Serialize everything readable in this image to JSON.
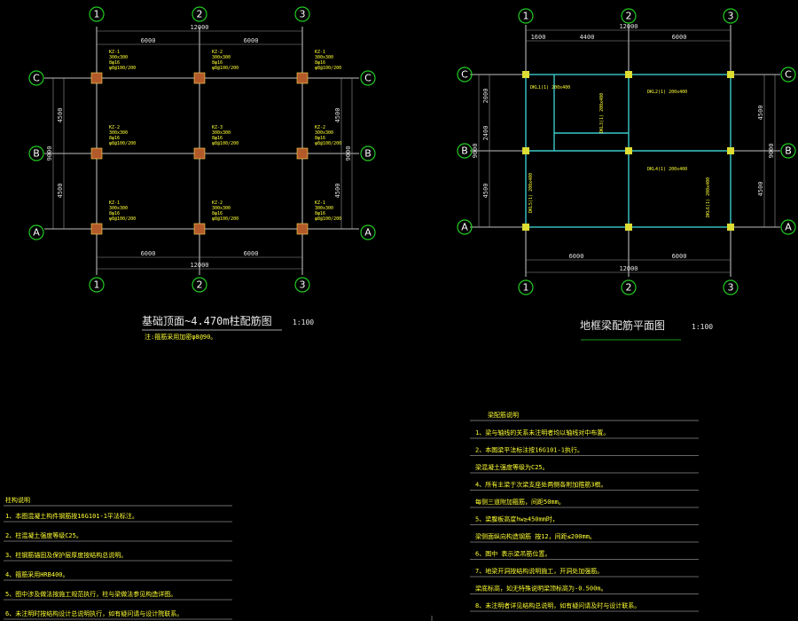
{
  "left_drawing": {
    "title": "基础顶面~4.470m柱配筋图",
    "scale": "1:100",
    "note": "注:箍筋采用加密φ8@90。",
    "axes_x": [
      "1",
      "2",
      "3"
    ],
    "axes_y": [
      "A",
      "B",
      "C"
    ],
    "dim_total": "12000",
    "dim_spans": [
      "6000",
      "6000"
    ],
    "dim_side": [
      "4500",
      "4500"
    ],
    "dim_side_total": "9000",
    "columns": [
      {
        "mark": "KZ-1",
        "size": "300x300",
        "bars": "8φ16",
        "stirrup": "φ8@100/200"
      },
      {
        "mark": "KZ-2",
        "size": "300x300",
        "bars": "8φ16",
        "stirrup": "φ8@100/200"
      },
      {
        "mark": "KZ-1",
        "size": "300x300",
        "bars": "8φ16",
        "stirrup": "φ8@100/200"
      },
      {
        "mark": "KZ-2",
        "size": "300x300",
        "bars": "8φ16",
        "stirrup": "φ8@100/200"
      },
      {
        "mark": "KZ-3",
        "size": "300x300",
        "bars": "8φ16",
        "stirrup": "φ8@100/200"
      },
      {
        "mark": "KZ-2",
        "size": "300x300",
        "bars": "8φ16",
        "stirrup": "φ8@100/200"
      },
      {
        "mark": "KZ-1",
        "size": "300x300",
        "bars": "8φ16",
        "stirrup": "φ8@100/200"
      },
      {
        "mark": "KZ-2",
        "size": "300x300",
        "bars": "8φ16",
        "stirrup": "φ8@100/200"
      },
      {
        "mark": "KZ-1",
        "size": "300x300",
        "bars": "8φ16",
        "stirrup": "φ8@100/200"
      }
    ]
  },
  "right_drawing": {
    "title": "地框梁配筋平面图",
    "scale": "1:100",
    "axes_x": [
      "1",
      "2",
      "3"
    ],
    "axes_y": [
      "A",
      "B",
      "C"
    ],
    "dim_total": "12000",
    "dim_top": [
      "1600",
      "4400",
      "6000"
    ],
    "dim_bottom": [
      "6000",
      "6000"
    ],
    "dim_left": [
      "2000",
      "2400",
      "4500"
    ],
    "dim_side_total": "9000",
    "dim_right": [
      "4500",
      "4500"
    ],
    "beam_labels": [
      "DKL1(1) 200x400",
      "DKL2(1) 200x400",
      "DKL3(1) 200x400",
      "DKL4(1) 200x400",
      "DKL5(1) 200x400",
      "DKL6(1) 200x400"
    ]
  },
  "notes_left": {
    "heading": "柱构说明",
    "lines": [
      "1、本图混凝土构件钢筋按16G101-1平法标注。",
      "2、柱混凝土强度等级C25。",
      "3、柱钢筋锚固及保护层厚度按结构总说明。",
      "4、箍筋采用HRB400。",
      "5、图中涉及做法按施工规范执行，柱与梁做法参见构造详图。",
      "6、未注明时按结构设计总说明执行，如有疑问请与设计院联系。"
    ]
  },
  "notes_right": {
    "heading": "梁配筋说明",
    "lines": [
      "1、梁与轴线的关系未注明者均以轴线对中布置。",
      "2、本图梁平法标注按16G101-1执行。",
      "梁混凝土强度等级为C25。",
      "4、所有主梁于次梁支座处两侧各附加箍筋3根。",
      "每侧三道附加箍筋，间距50mm。",
      "5、梁腹板高度hw≥450mm时，",
      "梁侧面纵向构造钢筋 按12，间距≤200mm。",
      "6、图中  表示梁吊筋位置。",
      "7、地梁开洞按结构说明施工，开洞处加强筋。",
      "梁底标高，如无特殊说明梁顶标高为-0.500m。",
      "8、未注明者详见结构总说明，如有疑问请及时与设计联系。"
    ]
  }
}
